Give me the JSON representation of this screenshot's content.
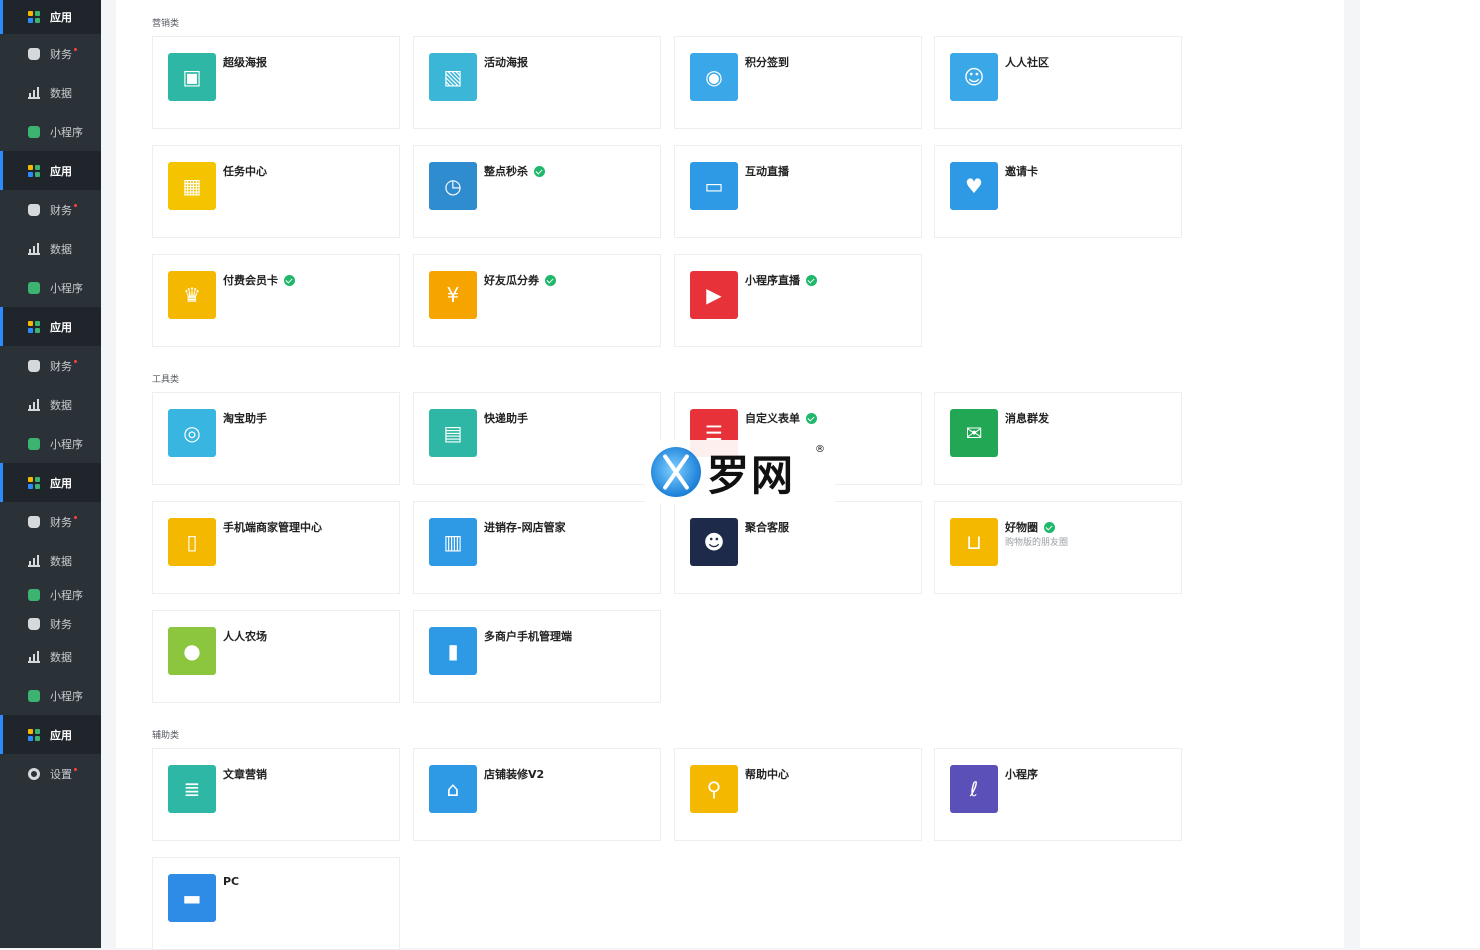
{
  "sidebar": {
    "items": [
      {
        "label": "应用",
        "icon": "apps-icon",
        "active": true
      },
      {
        "label": "财务",
        "icon": "money-bag-icon",
        "active": false,
        "dot": true
      },
      {
        "label": "数据",
        "icon": "bar-chart-icon",
        "active": false
      },
      {
        "label": "小程序",
        "icon": "mini-program-icon",
        "active": false
      },
      {
        "label": "应用",
        "icon": "apps-icon",
        "active": true
      },
      {
        "label": "财务",
        "icon": "money-bag-icon",
        "active": false,
        "dot": true
      },
      {
        "label": "数据",
        "icon": "bar-chart-icon",
        "active": false
      },
      {
        "label": "小程序",
        "icon": "mini-program-icon",
        "active": false
      },
      {
        "label": "应用",
        "icon": "apps-icon",
        "active": true
      },
      {
        "label": "财务",
        "icon": "money-bag-icon",
        "active": false,
        "dot": true
      },
      {
        "label": "数据",
        "icon": "bar-chart-icon",
        "active": false
      },
      {
        "label": "小程序",
        "icon": "mini-program-icon",
        "active": false
      },
      {
        "label": "应用",
        "icon": "apps-icon",
        "active": true
      },
      {
        "label": "财务",
        "icon": "money-bag-icon",
        "active": false,
        "dot": true
      },
      {
        "label": "数据",
        "icon": "bar-chart-icon",
        "active": false
      },
      {
        "label": "小程序",
        "icon": "mini-program-icon",
        "active": false
      },
      {
        "label": "财务",
        "icon": "money-bag-icon",
        "active": false
      },
      {
        "label": "数据",
        "icon": "bar-chart-icon",
        "active": false
      },
      {
        "label": "小程序",
        "icon": "mini-program-icon",
        "active": false
      },
      {
        "label": "应用",
        "icon": "apps-icon",
        "active": true
      },
      {
        "label": "设置",
        "icon": "gear-icon",
        "active": false,
        "dot": true
      }
    ]
  },
  "sections": [
    {
      "title": "营销类"
    },
    {
      "title": "工具类"
    },
    {
      "title": "辅助类"
    }
  ],
  "apps": [
    {
      "name": "超级海报",
      "icon": "poster-icon",
      "color": "#2db7a4",
      "verified": false,
      "sub": ""
    },
    {
      "name": "活动海报",
      "icon": "picture-icon",
      "color": "#3bb6d6",
      "verified": false,
      "sub": ""
    },
    {
      "name": "积分签到",
      "icon": "location-pin-icon",
      "color": "#3aa8e8",
      "verified": false,
      "sub": ""
    },
    {
      "name": "人人社区",
      "icon": "community-icon",
      "color": "#3aa8e8",
      "verified": false,
      "sub": ""
    },
    {
      "name": "任务中心",
      "icon": "qrcode-icon",
      "color": "#f5c400",
      "verified": false,
      "sub": ""
    },
    {
      "name": "整点秒杀",
      "icon": "alarm-clock-icon",
      "color": "#2e8ccf",
      "verified": true,
      "sub": ""
    },
    {
      "name": "互动直播",
      "icon": "tv-icon",
      "color": "#2e9ae6",
      "verified": false,
      "sub": ""
    },
    {
      "name": "邀请卡",
      "icon": "heart-card-icon",
      "color": "#2e9ae6",
      "verified": false,
      "sub": ""
    },
    {
      "name": "付费会员卡",
      "icon": "crown-card-icon",
      "color": "#f5b800",
      "verified": true,
      "sub": ""
    },
    {
      "name": "好友瓜分券",
      "icon": "red-envelope-icon",
      "color": "#f6a400",
      "verified": true,
      "sub": ""
    },
    {
      "name": "小程序直播",
      "icon": "live-tv-icon",
      "color": "#e8323a",
      "verified": true,
      "sub": ""
    },
    {
      "name": "淘宝助手",
      "icon": "glasses-icon",
      "color": "#38b5e0",
      "verified": false,
      "sub": ""
    },
    {
      "name": "快递助手",
      "icon": "package-icon",
      "color": "#2db7a4",
      "verified": false,
      "sub": ""
    },
    {
      "name": "自定义表单",
      "icon": "form-icon",
      "color": "#e8323a",
      "verified": true,
      "sub": ""
    },
    {
      "name": "消息群发",
      "icon": "broadcast-icon",
      "color": "#22a855",
      "verified": false,
      "sub": ""
    },
    {
      "name": "手机端商家管理中心",
      "icon": "phone-icon",
      "color": "#f5b800",
      "verified": false,
      "sub": ""
    },
    {
      "name": "进销存-网店管家",
      "icon": "inventory-icon",
      "color": "#2e9ae6",
      "verified": false,
      "sub": ""
    },
    {
      "name": "聚合客服",
      "icon": "chat-bubble-icon",
      "color": "#1d2a4a",
      "verified": false,
      "sub": ""
    },
    {
      "name": "好物圈",
      "icon": "cart-icon",
      "color": "#f5b800",
      "verified": true,
      "sub": "购物版的朋友圈"
    },
    {
      "name": "人人农场",
      "icon": "chicken-icon",
      "color": "#8cc63f",
      "verified": false,
      "sub": ""
    },
    {
      "name": "多商户手机管理端",
      "icon": "mobile-icon",
      "color": "#2e9ae6",
      "verified": false,
      "sub": ""
    },
    {
      "name": "文章营销",
      "icon": "article-icon",
      "color": "#2db7a4",
      "verified": false,
      "sub": ""
    },
    {
      "name": "店铺装修V2",
      "icon": "shop-icon",
      "color": "#2e9ae6",
      "verified": false,
      "sub": ""
    },
    {
      "name": "帮助中心",
      "icon": "magnifier-icon",
      "color": "#f5b800",
      "verified": false,
      "sub": ""
    },
    {
      "name": "小程序",
      "icon": "mini-program-icon",
      "color": "#5b4fb8",
      "verified": false,
      "sub": ""
    },
    {
      "name": "PC",
      "icon": "pc-icon",
      "color": "#2e8ce6",
      "verified": false,
      "sub": ""
    }
  ],
  "watermark": {
    "text": "罗网",
    "reg": "®"
  }
}
